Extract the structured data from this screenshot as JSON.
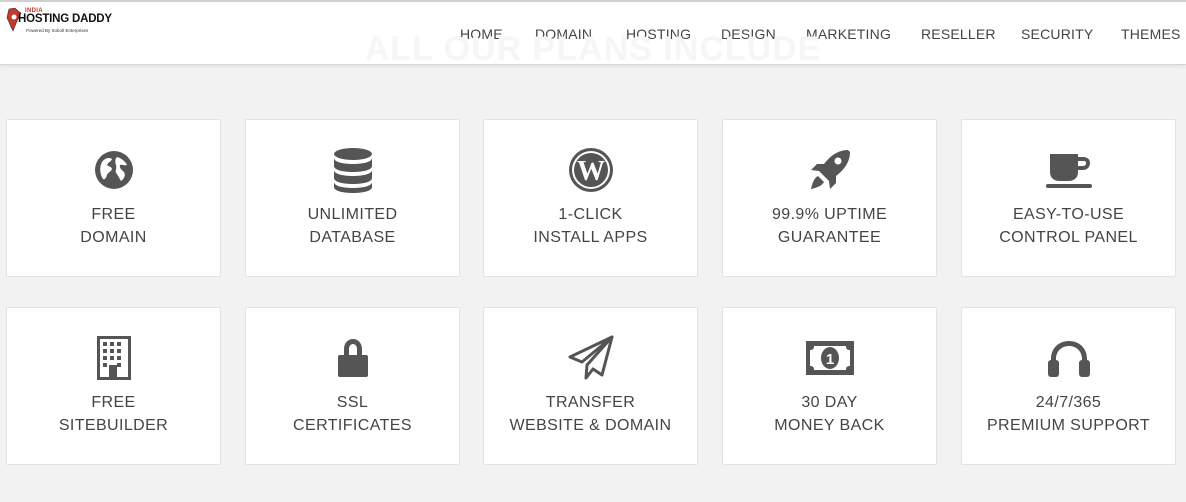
{
  "header": {
    "logo": {
      "india": "INDIA",
      "name": "HOSTING DADDY",
      "tagline": "Powered By Sobolt Enterprises"
    },
    "nav": [
      {
        "label": "HOME"
      },
      {
        "label": "DOMAIN"
      },
      {
        "label": "HOSTING"
      },
      {
        "label": "DESIGN"
      },
      {
        "label": "MARKETING"
      },
      {
        "label": "RESELLER"
      },
      {
        "label": "SECURITY"
      },
      {
        "label": "THEMES"
      }
    ]
  },
  "section": {
    "heading": "ALL OUR PLANS INCLUDE"
  },
  "features": [
    {
      "icon": "globe-icon",
      "line1": "FREE",
      "line2": "DOMAIN"
    },
    {
      "icon": "database-icon",
      "line1": "UNLIMITED",
      "line2": "DATABASE"
    },
    {
      "icon": "wordpress-icon",
      "line1": "1-CLICK",
      "line2": "INSTALL APPS"
    },
    {
      "icon": "rocket-icon",
      "line1": "99.9% UPTIME",
      "line2": "GUARANTEE"
    },
    {
      "icon": "coffee-cup-icon",
      "line1": "EASY-TO-USE",
      "line2": "CONTROL PANEL"
    },
    {
      "icon": "building-icon",
      "line1": "FREE",
      "line2": "SITEBUILDER"
    },
    {
      "icon": "lock-icon",
      "line1": "SSL",
      "line2": "CERTIFICATES"
    },
    {
      "icon": "paper-plane-icon",
      "line1": "TRANSFER",
      "line2": "WEBSITE & DOMAIN"
    },
    {
      "icon": "money-icon",
      "line1": "30 DAY",
      "line2": "MONEY BACK"
    },
    {
      "icon": "headphones-icon",
      "line1": "24/7/365",
      "line2": "PREMIUM SUPPORT"
    }
  ],
  "colors": {
    "icon": "#555555",
    "text": "#444444",
    "background": "#f2f2f2",
    "card": "#ffffff"
  }
}
